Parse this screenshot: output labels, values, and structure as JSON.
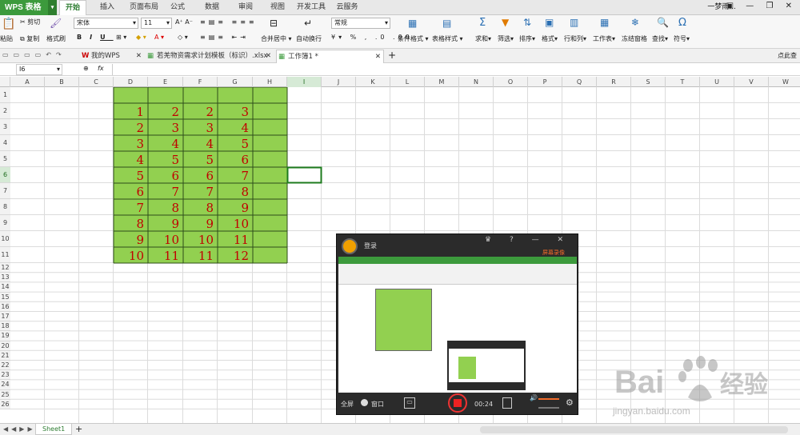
{
  "app": {
    "name": "WPS 表格",
    "user": "一梦雨..."
  },
  "menu_tabs": [
    "开始",
    "插入",
    "页面布局",
    "公式",
    "数据",
    "审阅",
    "视图",
    "开发工具",
    "云服务"
  ],
  "ribbon": {
    "paste": "粘贴",
    "cut": "剪切",
    "copy": "复制",
    "format_painter": "格式刷",
    "font_name": "宋体",
    "font_size": "11",
    "merge_center": "合并居中",
    "wrap_text": "自动换行",
    "number_format": "常规",
    "conditional_format": "条件格式",
    "table_style": "表格样式",
    "sum": "求和",
    "filter": "筛选",
    "sort": "排序",
    "format": "格式",
    "row_col": "行和列",
    "worksheet": "工作表",
    "freeze": "冻结窗格",
    "find": "查找",
    "symbol": "符号"
  },
  "doc_tabs": [
    "我的WPS",
    "若羌物资需求计划模板（标识）.xlsx",
    "工作簿1 *"
  ],
  "doc_right": "点此查",
  "formula_bar": {
    "cell_ref": "I6",
    "fx": "fx",
    "content": ""
  },
  "columns": [
    "A",
    "B",
    "C",
    "D",
    "E",
    "F",
    "G",
    "H",
    "I",
    "J",
    "K",
    "L",
    "M",
    "N",
    "O",
    "P",
    "Q",
    "R",
    "S",
    "T",
    "U",
    "V",
    "W"
  ],
  "rows": [
    "1",
    "2",
    "3",
    "4",
    "5",
    "6",
    "7",
    "8",
    "9",
    "10",
    "11",
    "12",
    "13",
    "14",
    "15",
    "16",
    "17",
    "18",
    "19",
    "20",
    "21",
    "22",
    "23",
    "24",
    "25",
    "26"
  ],
  "chart_data": {
    "type": "table",
    "columns": [
      "D",
      "E",
      "F",
      "G"
    ],
    "rows": [
      [
        1,
        2,
        2,
        3
      ],
      [
        2,
        3,
        3,
        4
      ],
      [
        3,
        4,
        4,
        5
      ],
      [
        4,
        5,
        5,
        6
      ],
      [
        5,
        6,
        6,
        7
      ],
      [
        6,
        7,
        7,
        8
      ],
      [
        7,
        8,
        8,
        9
      ],
      [
        8,
        9,
        9,
        10
      ],
      [
        9,
        10,
        10,
        11
      ],
      [
        10,
        11,
        11,
        12
      ]
    ],
    "fill_color": "#92d050",
    "text_color": "#c00000"
  },
  "recorder": {
    "title": "登录",
    "full": "全屏",
    "window": "窗口",
    "time": "00:24",
    "tag": "屏幕录像"
  },
  "sheet_tabs": [
    "Sheet1"
  ],
  "watermark": {
    "logo": "Bai du 经验",
    "url": "jingyan.baidu.com"
  }
}
